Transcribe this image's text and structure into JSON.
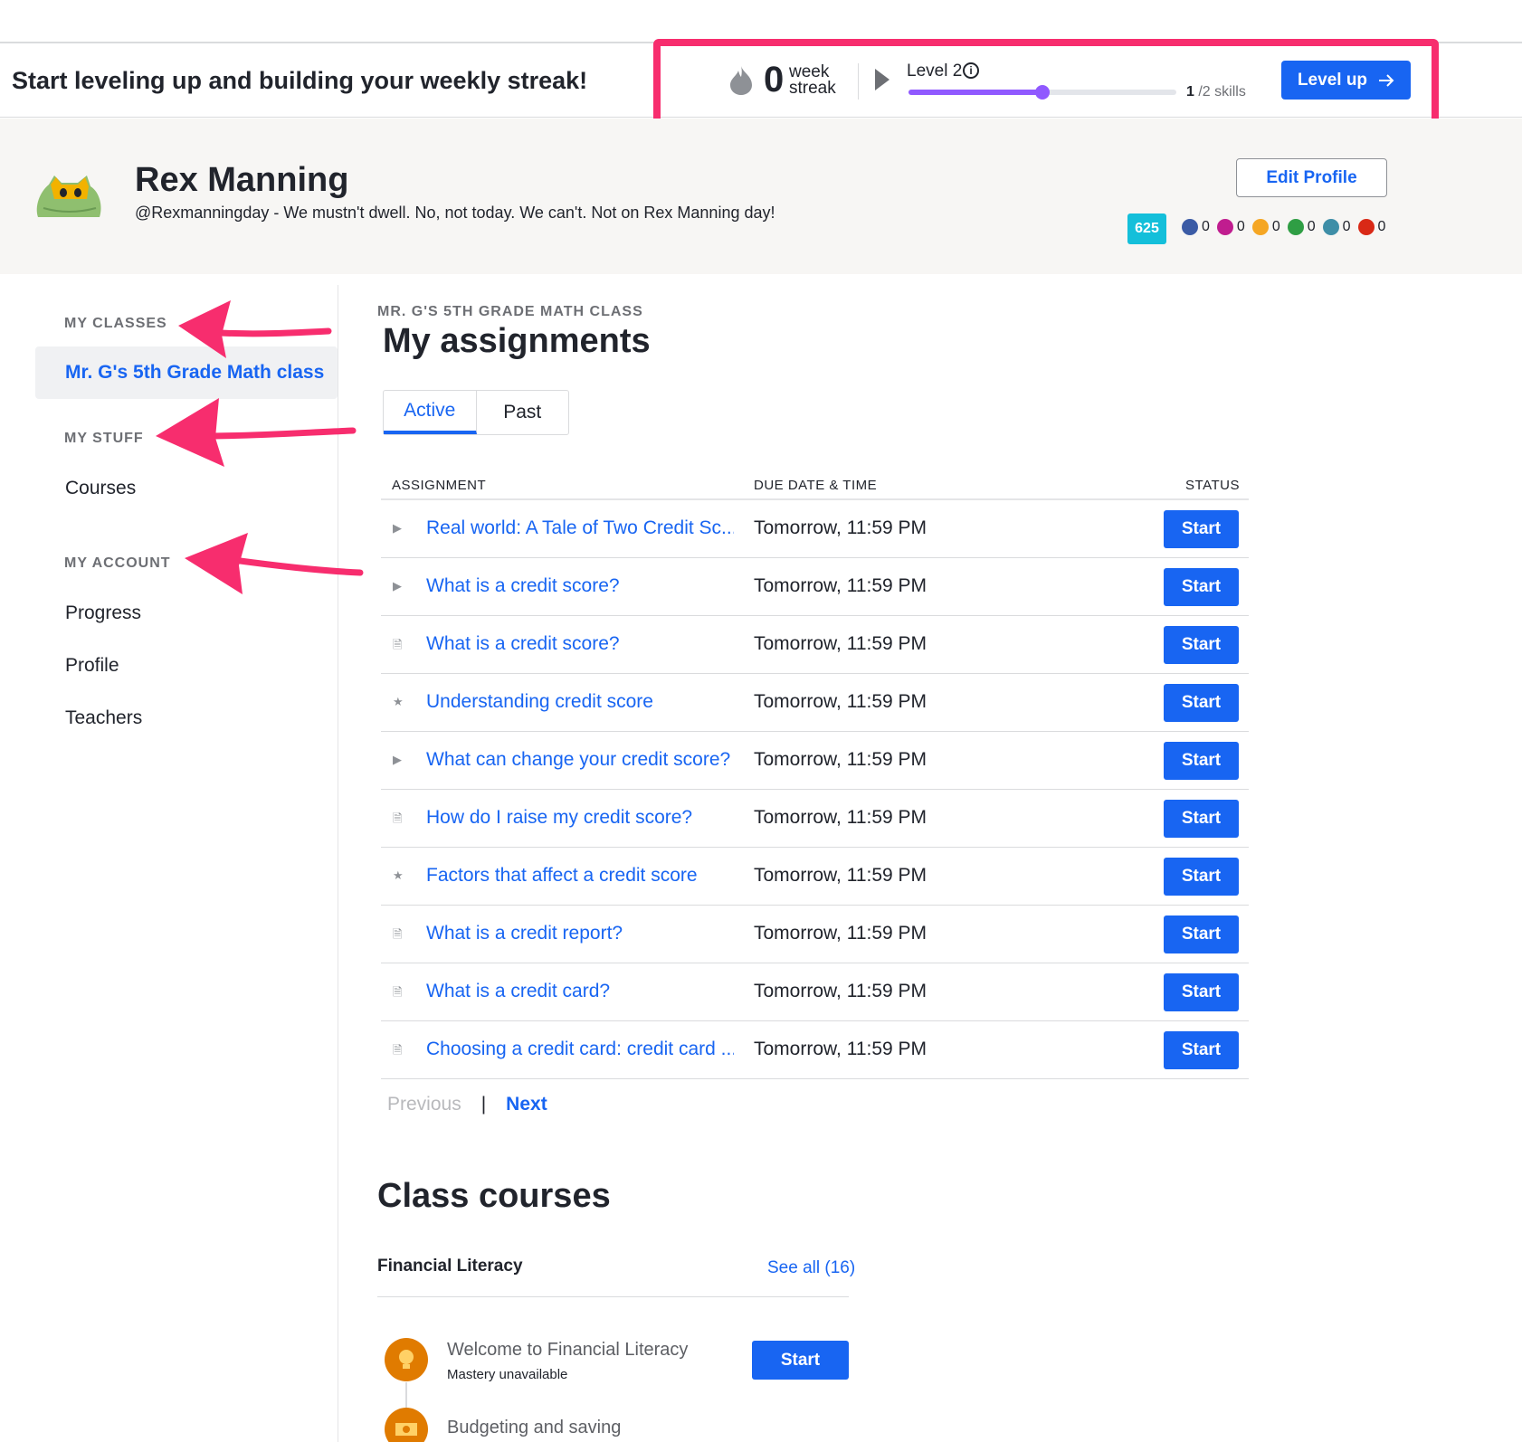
{
  "topbar": {
    "message": "Start leveling up and building your weekly streak!",
    "streak_count": "0",
    "streak_label_1": "week",
    "streak_label_2": "streak",
    "level_label": "Level 2",
    "level_progress_fraction": 0.5,
    "skills_done": "1",
    "skills_total": "/2 skills",
    "levelup_label": "Level up",
    "highlight_color": "#f72d6e"
  },
  "profile": {
    "name": "Rex Manning",
    "bio": "@Rexmanningday - We mustn't dwell. No, not today. We can't. Not on Rex Manning day!",
    "edit_label": "Edit Profile",
    "points": "625",
    "badges": [
      {
        "icon": "meteorite-badge-icon",
        "count": "0",
        "color": "#3b5ba5"
      },
      {
        "icon": "moon-badge-icon",
        "count": "0",
        "color": "#c01d8f"
      },
      {
        "icon": "earth-badge-icon",
        "count": "0",
        "color": "#f5a623"
      },
      {
        "icon": "sun-badge-icon",
        "count": "0",
        "color": "#2f9e44"
      },
      {
        "icon": "black-hole-badge-icon",
        "count": "0",
        "color": "#3e8ea7"
      },
      {
        "icon": "challenge-patch-icon",
        "count": "0",
        "color": "#d92916"
      }
    ]
  },
  "sidebar": {
    "my_classes": "MY CLASSES",
    "active_class": "Mr. G's 5th Grade Math class",
    "my_stuff": "MY STUFF",
    "courses": "Courses",
    "my_account": "MY ACCOUNT",
    "progress": "Progress",
    "profile": "Profile",
    "teachers": "Teachers"
  },
  "main": {
    "class_label": "MR. G'S 5TH GRADE MATH CLASS",
    "title": "My assignments",
    "tabs": [
      "Active",
      "Past"
    ],
    "columns": [
      "ASSIGNMENT",
      "DUE DATE & TIME",
      "STATUS"
    ],
    "rows": [
      {
        "icon": "▶",
        "icon_name": "video-icon",
        "title": "Real world: A Tale of Two Credit Sc...",
        "due": "Tomorrow, 11:59 PM",
        "action": "Start"
      },
      {
        "icon": "▶",
        "icon_name": "video-icon",
        "title": "What is a credit score?",
        "due": "Tomorrow, 11:59 PM",
        "action": "Start"
      },
      {
        "icon": "🗎",
        "icon_name": "article-icon",
        "title": "What is a credit score?",
        "due": "Tomorrow, 11:59 PM",
        "action": "Start"
      },
      {
        "icon": "★",
        "icon_name": "exercise-star-icon",
        "title": "Understanding credit score",
        "due": "Tomorrow, 11:59 PM",
        "action": "Start"
      },
      {
        "icon": "▶",
        "icon_name": "video-icon",
        "title": "What can change your credit score?",
        "due": "Tomorrow, 11:59 PM",
        "action": "Start"
      },
      {
        "icon": "🗎",
        "icon_name": "article-icon",
        "title": "How do I raise my credit score?",
        "due": "Tomorrow, 11:59 PM",
        "action": "Start"
      },
      {
        "icon": "★",
        "icon_name": "exercise-star-icon",
        "title": "Factors that affect a credit score",
        "due": "Tomorrow, 11:59 PM",
        "action": "Start"
      },
      {
        "icon": "🗎",
        "icon_name": "article-icon",
        "title": "What is a credit report?",
        "due": "Tomorrow, 11:59 PM",
        "action": "Start"
      },
      {
        "icon": "🗎",
        "icon_name": "article-icon",
        "title": "What is a credit card?",
        "due": "Tomorrow, 11:59 PM",
        "action": "Start"
      },
      {
        "icon": "🗎",
        "icon_name": "article-icon",
        "title": "Choosing a credit card: credit card ...",
        "due": "Tomorrow, 11:59 PM",
        "action": "Start"
      }
    ],
    "pager": {
      "prev": "Previous",
      "sep": "|",
      "next": "Next"
    },
    "courses_title": "Class courses",
    "course_name": "Financial Literacy",
    "see_all": "See all (16)",
    "units": [
      {
        "title": "Welcome to Financial Literacy",
        "sub": "Mastery unavailable",
        "action": "Start"
      },
      {
        "title": "Budgeting and saving"
      }
    ]
  }
}
